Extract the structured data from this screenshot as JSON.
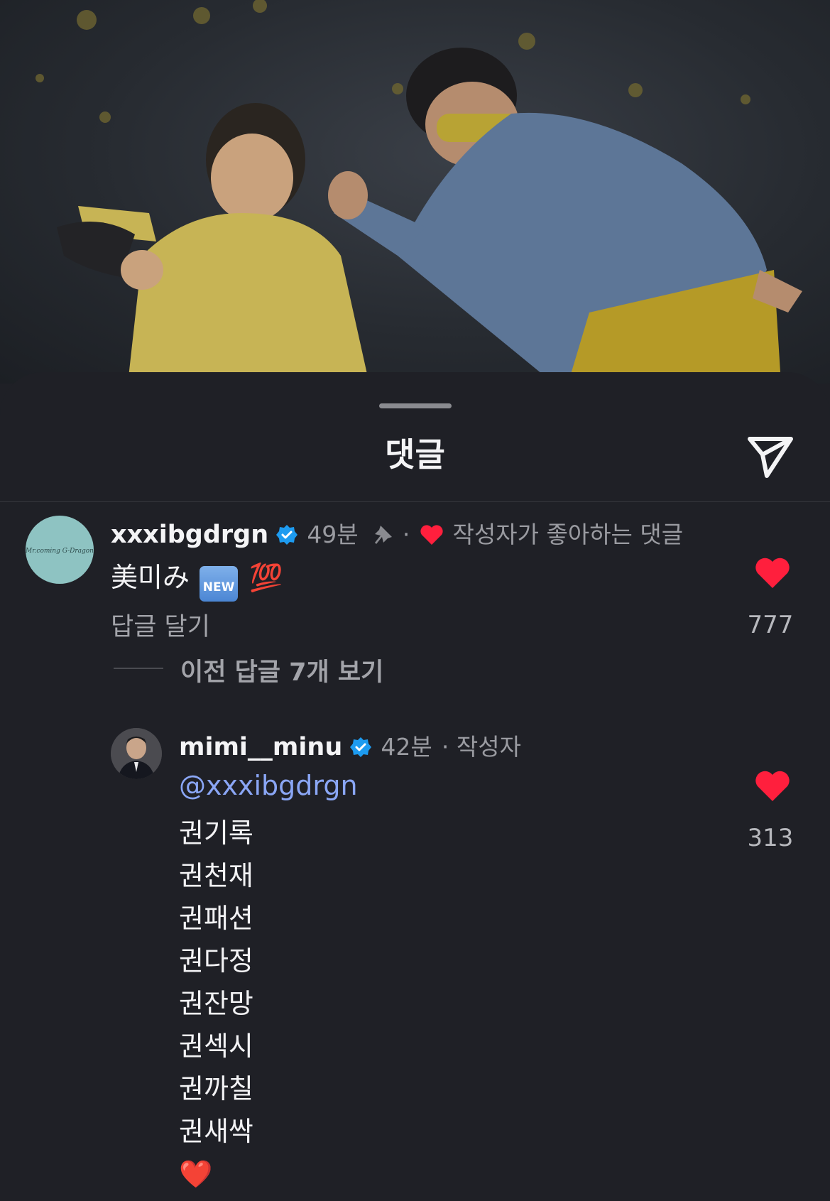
{
  "sheet": {
    "title": "댓글"
  },
  "comments": [
    {
      "username": "xxxibgdrgn",
      "avatar_text": "Mr.coming G-Dragon",
      "time": "49분",
      "creator_liked": "작성자가 좋아하는 댓글",
      "text": "美미み",
      "badge_new": "NEW",
      "emoji_100": "💯",
      "reply_label": "답글 달기",
      "likes": "777",
      "view_replies": "이전 답글 7개 보기"
    },
    {
      "username": "mimi__minu",
      "time": "42분",
      "author_tag": "· 작성자",
      "mention": "@xxxibgdrgn",
      "lines": [
        "권기록",
        "권천재",
        "권패션",
        "권다정",
        "권잔망",
        "권섹시",
        "권까칠",
        "권새싹"
      ],
      "end_emoji": "❤️",
      "likes": "313"
    }
  ],
  "colors": {
    "like_red": "#ff1f3d",
    "verified_blue": "#1d9bf0",
    "mention_blue": "#8aa6f5"
  },
  "icons": [
    "share-send-icon",
    "verified-badge-icon",
    "pin-icon",
    "heart-icon"
  ]
}
